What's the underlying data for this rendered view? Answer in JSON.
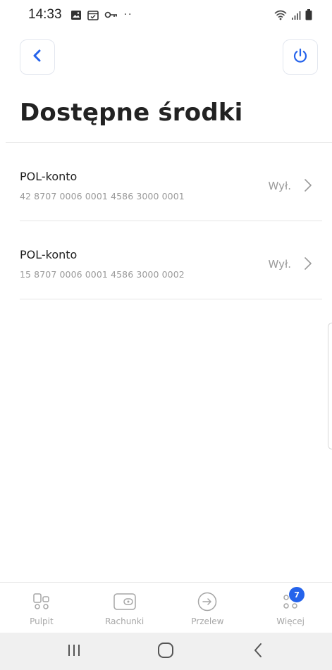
{
  "status_bar": {
    "time": "14:33",
    "more_indicator": "··"
  },
  "colors": {
    "accent": "#2563eb",
    "title": "#222222",
    "muted": "#9a9a9a",
    "nav_inactive": "#a6a6a6",
    "badge": "#2563eb"
  },
  "header": {
    "title": "Dostępne środki",
    "back_icon": "chevron-left-icon",
    "power_icon": "power-icon"
  },
  "accounts": [
    {
      "name": "POL-konto",
      "number": "42 8707 0006 0001 4586 3000 0001",
      "status": "Wył."
    },
    {
      "name": "POL-konto",
      "number": "15 8707 0006 0001 4586 3000 0002",
      "status": "Wył."
    }
  ],
  "bottom_nav": {
    "items": [
      {
        "label": "Pulpit",
        "icon": "dashboard-icon"
      },
      {
        "label": "Rachunki",
        "icon": "wallet-icon"
      },
      {
        "label": "Przelew",
        "icon": "transfer-arrow-icon"
      },
      {
        "label": "Więcej",
        "icon": "more-dots-icon",
        "badge": "7"
      }
    ]
  },
  "system_nav": {
    "recents_icon": "recents-icon",
    "home_icon": "home-icon",
    "back_icon": "back-icon"
  }
}
